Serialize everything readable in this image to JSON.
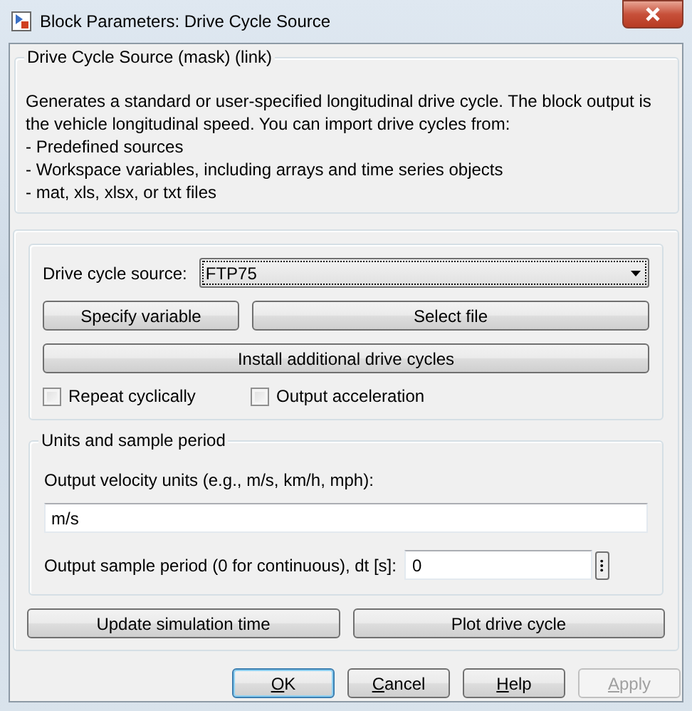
{
  "window": {
    "title": "Block Parameters: Drive Cycle Source"
  },
  "description": {
    "title": "Drive Cycle Source (mask) (link)",
    "text": "Generates a standard or user-specified longitudinal drive cycle. The block output is the vehicle longitudinal speed. You can import drive cycles from:",
    "bullets": [
      "- Predefined sources",
      "- Workspace variables, including arrays and time series objects",
      "- mat, xls, xlsx, or txt files"
    ]
  },
  "parameters": {
    "source": {
      "label": "Drive cycle source:",
      "value": "FTP75"
    },
    "source_buttons": [
      {
        "label": "Specify variable"
      },
      {
        "label": "Select file"
      }
    ],
    "install_button": {
      "label": "Install additional drive cycles"
    },
    "options": [
      {
        "label": "Repeat cyclically",
        "checked": false
      },
      {
        "label": "Output acceleration",
        "checked": false
      }
    ],
    "units_group": {
      "title": "Units and sample period",
      "fields": [
        {
          "kind": "stacked",
          "label": "Output velocity units (e.g., m/s, km/h, mph):",
          "value": "m/s"
        },
        {
          "kind": "inline",
          "label": "Output sample period (0 for continuous), dt [s]:",
          "value": "0"
        }
      ]
    },
    "actions": [
      {
        "label": "Update simulation time"
      },
      {
        "label": "Plot drive cycle"
      }
    ]
  },
  "dialog_buttons": [
    {
      "label": "OK",
      "default": true,
      "disabled": false
    },
    {
      "label": "Cancel",
      "default": false,
      "disabled": false
    },
    {
      "label": "Help",
      "default": false,
      "disabled": false
    },
    {
      "label": "Apply",
      "default": false,
      "disabled": true
    }
  ]
}
